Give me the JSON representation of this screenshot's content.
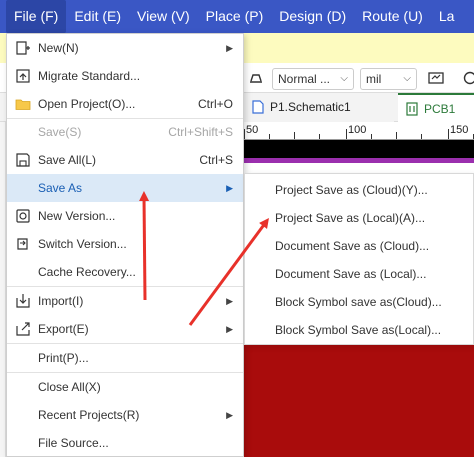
{
  "menubar": {
    "items": [
      "File (F)",
      "Edit (E)",
      "View (V)",
      "Place (P)",
      "Design (D)",
      "Route (U)",
      "La"
    ]
  },
  "toolbar": {
    "line_style": "Normal ...",
    "unit": "mil"
  },
  "tabs": {
    "schematic": "P1.Schematic1",
    "pcb": "PCB1"
  },
  "ruler": {
    "labels": [
      "50",
      "100",
      "150"
    ]
  },
  "file_menu": {
    "items": [
      {
        "label": "New(N)",
        "icon": "new-document-icon",
        "submenu": true
      },
      {
        "label": "Migrate Standard...",
        "icon": "migrate-icon"
      },
      {
        "label": "Open Project(O)...",
        "icon": "folder-icon",
        "shortcut": "Ctrl+O"
      },
      {
        "label": "Save(S)",
        "shortcut": "Ctrl+Shift+S",
        "disabled": true
      },
      {
        "label": "Save All(L)",
        "icon": "save-all-icon",
        "shortcut": "Ctrl+S"
      },
      {
        "label": "Save As",
        "submenu": true,
        "highlighted": true
      },
      {
        "label": "New Version...",
        "icon": "new-version-icon"
      },
      {
        "label": "Switch Version...",
        "icon": "switch-version-icon"
      },
      {
        "label": "Cache Recovery..."
      },
      {
        "label": "Import(I)",
        "icon": "import-icon",
        "submenu": true
      },
      {
        "label": "Export(E)",
        "icon": "export-icon",
        "submenu": true
      },
      {
        "label": "Print(P)..."
      },
      {
        "label": "Close All(X)"
      },
      {
        "label": "Recent Projects(R)",
        "submenu": true
      },
      {
        "label": "File Source..."
      }
    ]
  },
  "save_as_submenu": {
    "items": [
      "Project Save as (Cloud)(Y)...",
      "Project Save as (Local)(A)...",
      "Document Save as (Cloud)...",
      "Document Save as (Local)...",
      "Block Symbol save as(Cloud)...",
      "Block Symbol Save as(Local)..."
    ]
  },
  "colors": {
    "menubar": "#3a57c5",
    "highlight": "#dbe9f7",
    "annotation_arrow": "#e8312a",
    "canvas_red": "#a90c0c",
    "pcb_tab": "#2c7a3a"
  }
}
